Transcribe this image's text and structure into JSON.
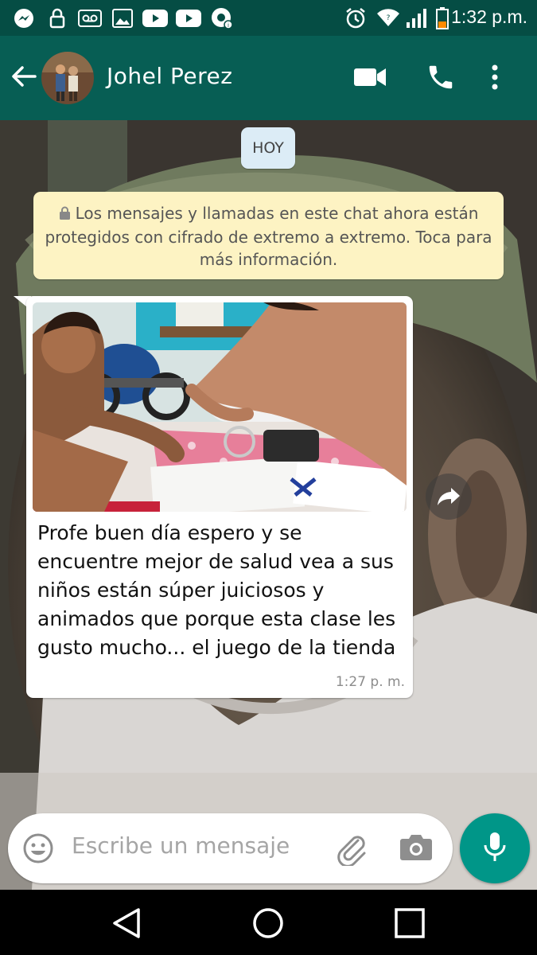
{
  "status_bar": {
    "time": "1:32 p.m.",
    "left_icons": [
      "messenger-icon",
      "lock-icon",
      "voicemail-icon",
      "gallery-icon",
      "youtube-icon",
      "youtube-icon",
      "chrome-icon"
    ],
    "right_icons": [
      "alarm-icon",
      "wifi-icon",
      "signal-icon",
      "battery-icon"
    ]
  },
  "header": {
    "contact_name": "Johel Perez",
    "icons": [
      "back-arrow-icon",
      "video-call-icon",
      "phone-icon",
      "more-vert-icon"
    ]
  },
  "chat": {
    "date_chip": "HOY",
    "e2e_notice": "Los mensajes y llamadas en este chat ahora están protegidos con cifrado de extremo a extremo. Toca para más información.",
    "messages": [
      {
        "text": "Profe buen día espero y se encuentre mejor de salud vea a sus niños están súper juiciosos y animados que porque esta clase les gusto mucho... el juego de la tienda",
        "time": "1:27 p. m.",
        "has_photo": true
      }
    ]
  },
  "composer": {
    "placeholder": "Escribe un mensaje",
    "icons": [
      "emoji-icon",
      "attach-icon",
      "camera-icon",
      "mic-icon"
    ]
  },
  "colors": {
    "header": "#075e54",
    "status_bar": "#054d44",
    "accent": "#009688",
    "bubble": "#ffffff",
    "notice": "#fdf3c3",
    "date_chip": "#dcecf6"
  }
}
